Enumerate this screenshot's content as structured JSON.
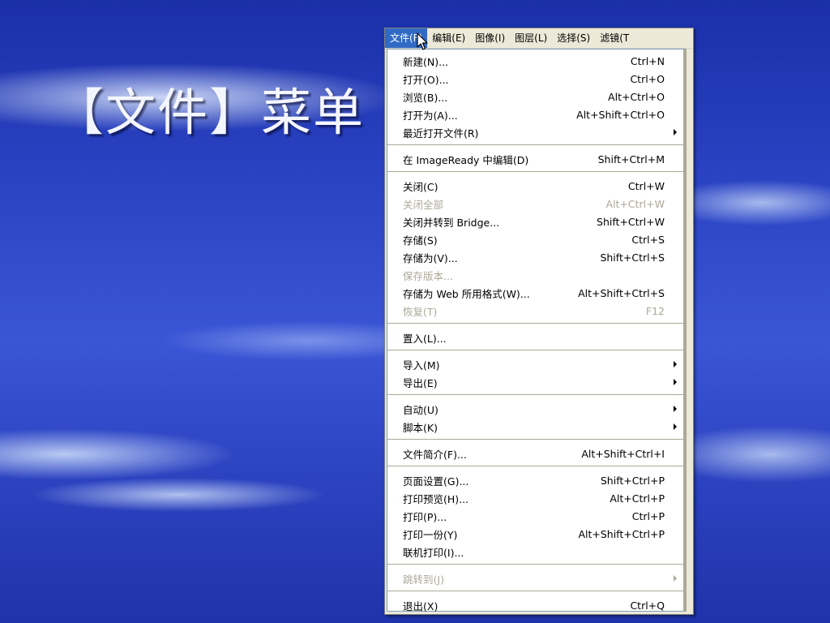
{
  "slide": {
    "title": "【文件】菜单"
  },
  "menubar": {
    "items": [
      {
        "label": "文件(F)",
        "active": true
      },
      {
        "label": "编辑(E)"
      },
      {
        "label": "图像(I)"
      },
      {
        "label": "图层(L)"
      },
      {
        "label": "选择(S)"
      },
      {
        "label": "滤镜(T"
      }
    ]
  },
  "file_menu": {
    "groups": [
      [
        {
          "label": "新建(N)...",
          "shortcut": "Ctrl+N"
        },
        {
          "label": "打开(O)...",
          "shortcut": "Ctrl+O"
        },
        {
          "label": "浏览(B)...",
          "shortcut": "Alt+Ctrl+O"
        },
        {
          "label": "打开为(A)...",
          "shortcut": "Alt+Shift+Ctrl+O"
        },
        {
          "label": "最近打开文件(R)",
          "submenu": true
        }
      ],
      [
        {
          "label": "在 ImageReady 中编辑(D)",
          "shortcut": "Shift+Ctrl+M"
        }
      ],
      [
        {
          "label": "关闭(C)",
          "shortcut": "Ctrl+W"
        },
        {
          "label": "关闭全部",
          "shortcut": "Alt+Ctrl+W",
          "disabled": true
        },
        {
          "label": "关闭并转到 Bridge...",
          "shortcut": "Shift+Ctrl+W"
        },
        {
          "label": "存储(S)",
          "shortcut": "Ctrl+S"
        },
        {
          "label": "存储为(V)...",
          "shortcut": "Shift+Ctrl+S"
        },
        {
          "label": "保存版本...",
          "disabled": true
        },
        {
          "label": "存储为 Web 所用格式(W)...",
          "shortcut": "Alt+Shift+Ctrl+S"
        },
        {
          "label": "恢复(T)",
          "shortcut": "F12",
          "disabled": true
        }
      ],
      [
        {
          "label": "置入(L)..."
        }
      ],
      [
        {
          "label": "导入(M)",
          "submenu": true
        },
        {
          "label": "导出(E)",
          "submenu": true
        }
      ],
      [
        {
          "label": "自动(U)",
          "submenu": true
        },
        {
          "label": "脚本(K)",
          "submenu": true
        }
      ],
      [
        {
          "label": "文件简介(F)...",
          "shortcut": "Alt+Shift+Ctrl+I"
        }
      ],
      [
        {
          "label": "页面设置(G)...",
          "shortcut": "Shift+Ctrl+P"
        },
        {
          "label": "打印预览(H)...",
          "shortcut": "Alt+Ctrl+P"
        },
        {
          "label": "打印(P)...",
          "shortcut": "Ctrl+P"
        },
        {
          "label": "打印一份(Y)",
          "shortcut": "Alt+Shift+Ctrl+P"
        },
        {
          "label": "联机打印(I)..."
        }
      ],
      [
        {
          "label": "跳转到(J)",
          "submenu": true,
          "disabled": true
        }
      ],
      [
        {
          "label": "退出(X)",
          "shortcut": "Ctrl+Q"
        }
      ]
    ]
  },
  "colors": {
    "menu_highlight": "#316ac5",
    "disabled_text": "#aca899"
  }
}
